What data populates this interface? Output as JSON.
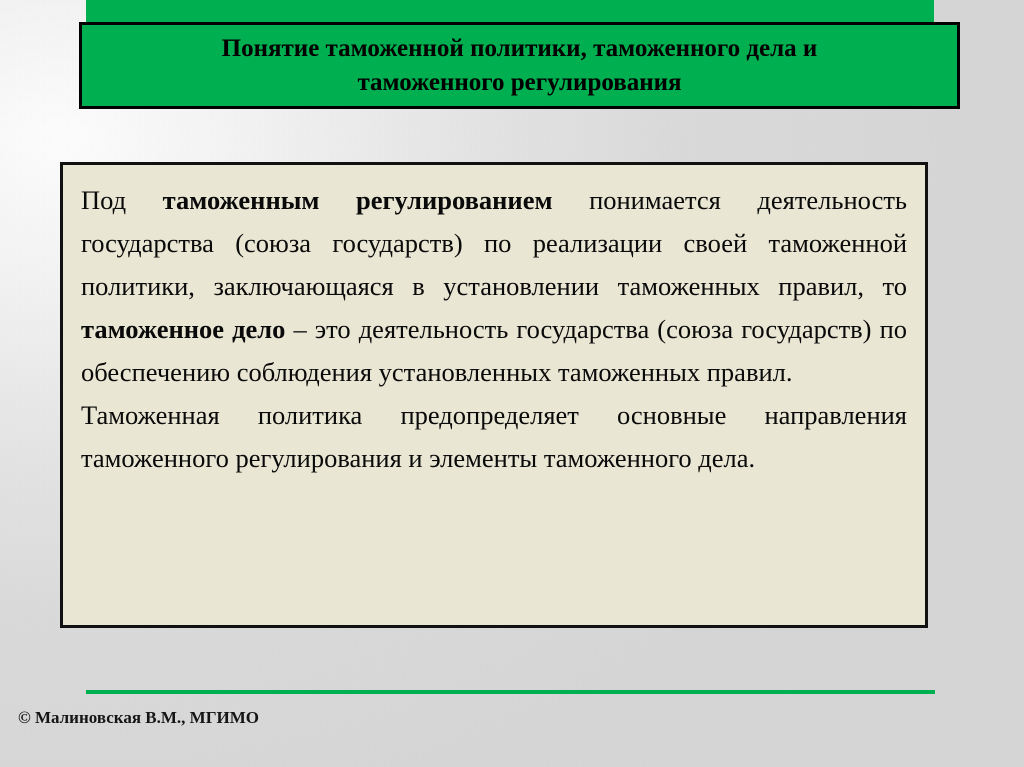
{
  "slide": {
    "title": "Понятие таможенной политики, таможенного дела и таможенного регулирования",
    "title_line_1": "Понятие таможенной политики, таможенного дела и",
    "title_line_2": "таможенного регулирования",
    "body": {
      "paragraph_1_parts": [
        {
          "text": "Под ",
          "bold": false
        },
        {
          "text": "таможенным регулированием",
          "bold": true
        },
        {
          "text": " понимается деятельность государства (союза государств) по реализации своей таможенной политики, заключающаяся в установлении таможенных правил, то ",
          "bold": false
        },
        {
          "text": "таможенное дело",
          "bold": true
        },
        {
          "text": " – это деятельность государства (союза государств) по обеспечению соблюдения установленных таможенных правил.",
          "bold": false
        }
      ],
      "paragraph_1_plain": "Под таможенным регулированием понимается деятельность государства (союза государств) по реализации своей таможенной политики, заключающаяся в установлении таможенных правил, то таможенное дело – это деятельность государства (союза государств) по обеспечению соблюдения установленных таможенных правил.",
      "paragraph_2": "Таможенная политика предопределяет основные направления таможенного регулирования и элементы таможенного дела."
    },
    "footer": {
      "credit": "© Малиновская В.М., МГИМО"
    },
    "colors": {
      "accent_green": "#00AF50",
      "content_background": "#E9E6D4",
      "border_black": "#111111",
      "page_background": "#DCDCDC",
      "text": "#0A0A0A"
    }
  }
}
